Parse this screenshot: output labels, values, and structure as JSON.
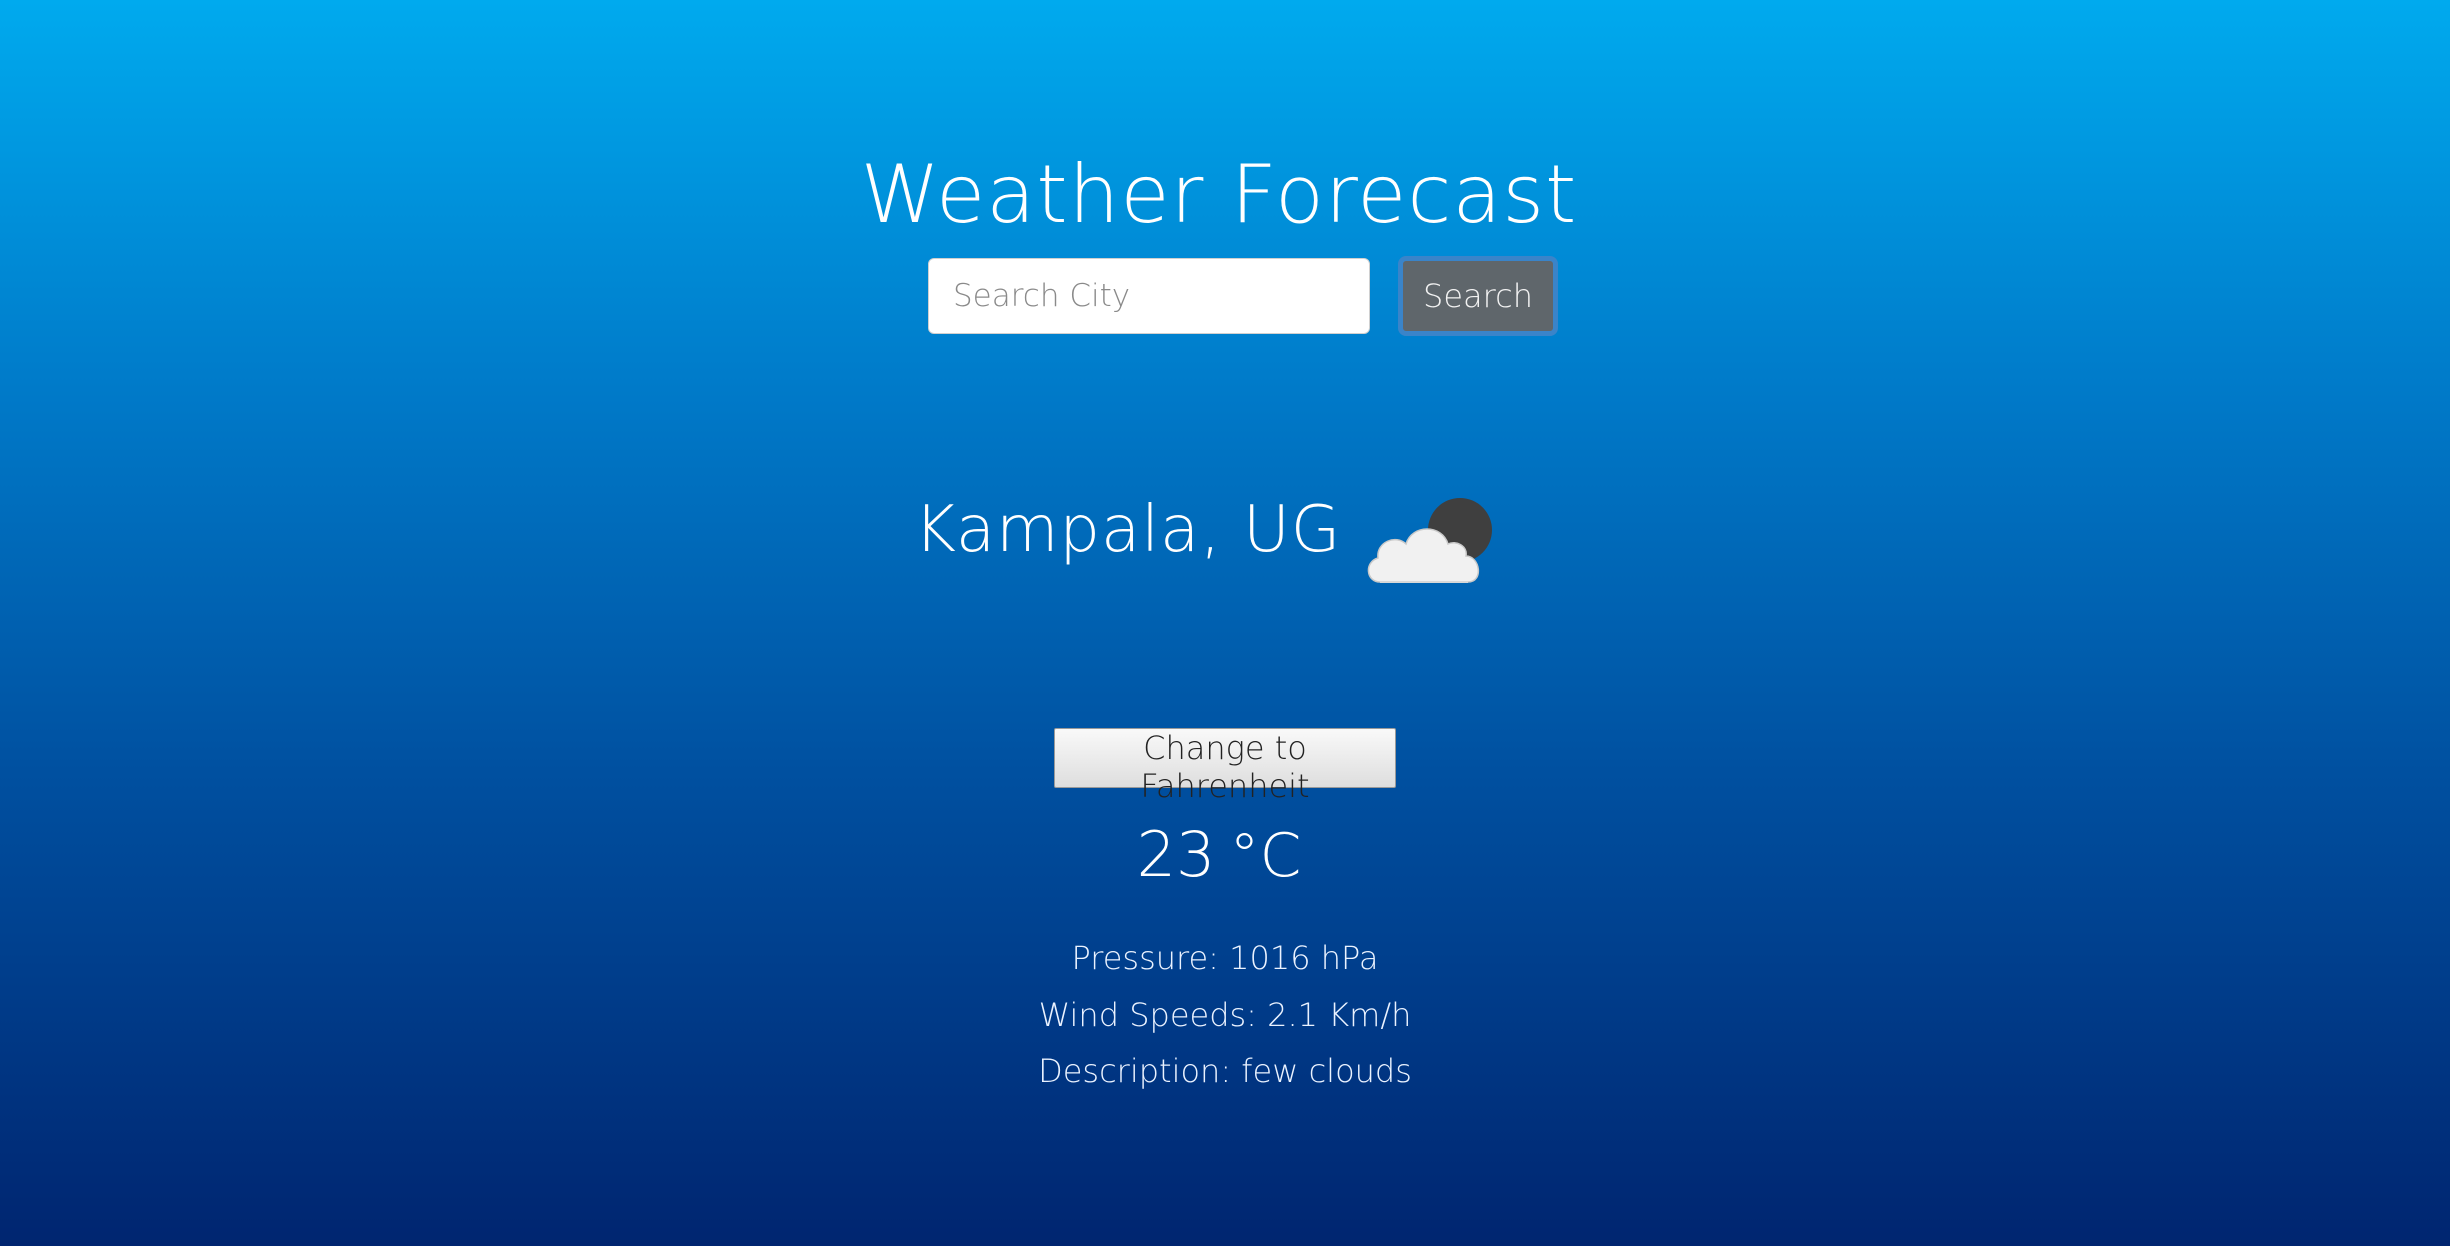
{
  "header": {
    "title": "Weather Forecast"
  },
  "search": {
    "placeholder": "Search City",
    "value": "",
    "button_label": "Search"
  },
  "location": {
    "city": "Kampala, UG",
    "icon": "cloud-moon-icon"
  },
  "units": {
    "toggle_label": "Change to Fahrenheit"
  },
  "current": {
    "temperature": "23",
    "temperature_unit": "°C",
    "pressure": "Pressure: 1016 hPa",
    "wind_speed": "Wind Speeds: 2.1 Km/h",
    "description": "Description: few clouds"
  },
  "colors": {
    "background_top": "#00aaee",
    "background_bottom": "#002570",
    "search_button_bg": "#5f666b",
    "search_button_focus_ring": "#3a84c9"
  }
}
